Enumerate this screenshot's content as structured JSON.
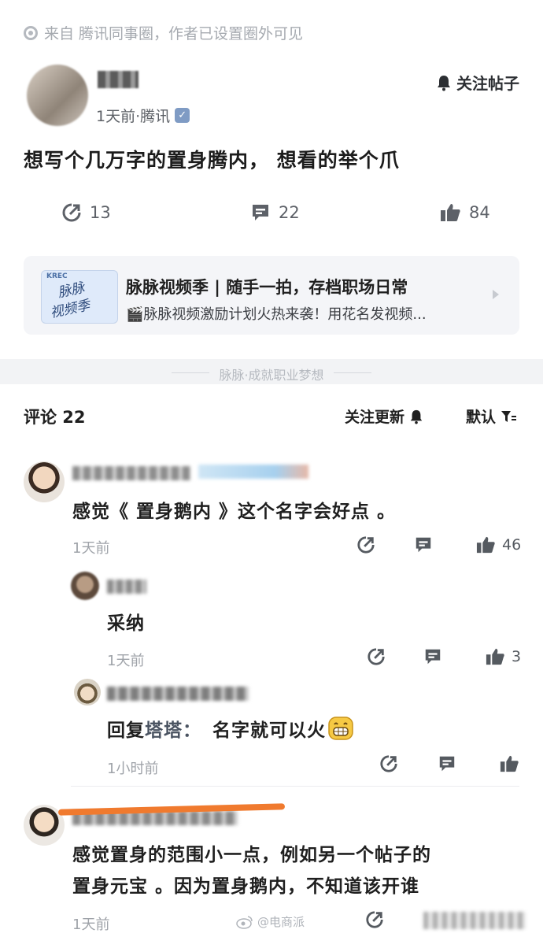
{
  "source": {
    "text": "来自 腾讯同事圈，作者已设置圈外可见"
  },
  "author": {
    "meta": "1天前·腾讯",
    "verified_mark": "✓"
  },
  "post": {
    "follow_label": "关注帖子",
    "text": "想写个几万字的置身腾内， 想看的举个爪",
    "stats": {
      "shares": "13",
      "comments": "22",
      "likes": "84"
    }
  },
  "promo": {
    "thumb_top": "KREC",
    "thumb_line1": "脉脉",
    "thumb_line2": "视频季",
    "title": "脉脉视频季 | 随手一拍，存档职场日常",
    "subtitle": "🎬脉脉视频激励计划火热来袭！用花名发视频..."
  },
  "divider": {
    "text": "脉脉·成就职业梦想"
  },
  "comments_header": {
    "title": "评论 22",
    "follow_updates": "关注更新",
    "sort": "默认"
  },
  "comments": [
    {
      "text": "感觉《 置身鹅内 》这个名字会好点 。",
      "time": "1天前",
      "likes": "46"
    },
    {
      "text": "采纳",
      "time": "1天前",
      "likes": "3"
    },
    {
      "reply_prefix": "回复 ",
      "reply_to": "塔塔：",
      "text": "名字就可以火",
      "time": "1小时前",
      "likes": ""
    },
    {
      "text_line1": "感觉置身的范围小一点，例如另一个帖子的",
      "text_line2": "置身元宝 。因为置身鹅内，不知道该开谁",
      "time": "1天前"
    }
  ],
  "watermark": {
    "text": "@电商派"
  },
  "colors": {
    "accent_orange": "#f07a2e",
    "verified_blue": "#7f9bc4",
    "band_gray": "#f2f3f5"
  }
}
